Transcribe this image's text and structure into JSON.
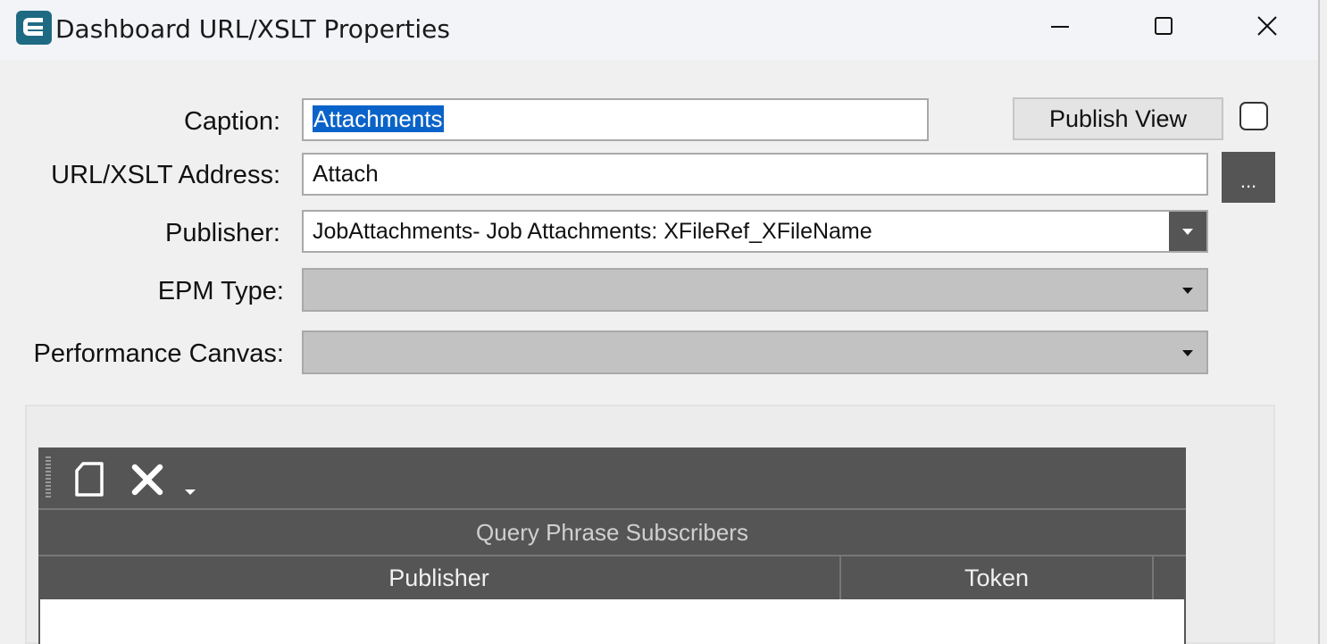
{
  "window": {
    "title": "Dashboard URL/XSLT Properties"
  },
  "form": {
    "caption_label": "Caption:",
    "caption_value": "Attachments",
    "url_label": "URL/XSLT Address:",
    "url_value": "Attach",
    "publisher_label": "Publisher:",
    "publisher_value": "JobAttachments- Job Attachments: XFileRef_XFileName",
    "epm_label": "EPM Type:",
    "epm_value": "",
    "canvas_label": "Performance Canvas:",
    "canvas_value": "",
    "publish_view_label": "Publish View",
    "publish_view_checked": false,
    "browse_label": "..."
  },
  "grid": {
    "title": "Query Phrase Subscribers",
    "columns": [
      "Publisher",
      "Token"
    ],
    "rows": []
  },
  "icons": {
    "app": "epicor-e-icon",
    "minimize": "minimize-icon",
    "maximize": "maximize-icon",
    "close": "close-icon",
    "new": "new-document-icon",
    "delete": "delete-x-icon",
    "dropdown": "chevron-down-icon"
  },
  "colors": {
    "selection": "#0a63c9",
    "dark_gray": "#555555",
    "disabled_combo": "#c2c2c2"
  }
}
